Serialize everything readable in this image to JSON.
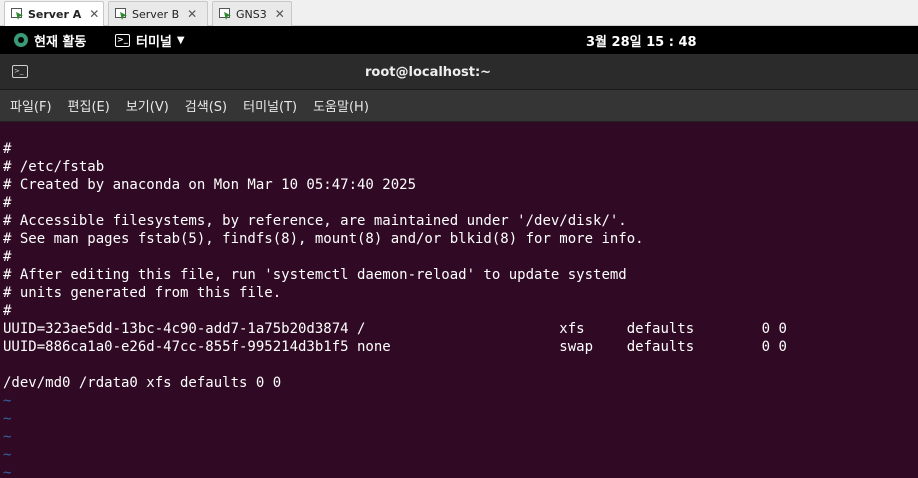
{
  "tabs": [
    {
      "label": "Server A",
      "active": true,
      "closable": true
    },
    {
      "label": "Server B",
      "active": false,
      "closable": true
    },
    {
      "label": "GNS3",
      "active": false,
      "closable": true
    }
  ],
  "topbar": {
    "activities": "현재 활동",
    "app_menu": "터미널",
    "clock": "3월 28일  15 : 48"
  },
  "window": {
    "title": "root@localhost:~"
  },
  "menu": [
    "파일(F)",
    "편집(E)",
    "보기(V)",
    "검색(S)",
    "터미널(T)",
    "도움말(H)"
  ],
  "terminal": {
    "lines": [
      "#",
      "# /etc/fstab",
      "# Created by anaconda on Mon Mar 10 05:47:40 2025",
      "#",
      "# Accessible filesystems, by reference, are maintained under '/dev/disk/'.",
      "# See man pages fstab(5), findfs(8), mount(8) and/or blkid(8) for more info.",
      "#",
      "# After editing this file, run 'systemctl daemon-reload' to update systemd",
      "# units generated from this file.",
      "#",
      "UUID=323ae5dd-13bc-4c90-add7-1a75b20d3874 /                       xfs     defaults        0 0",
      "UUID=886ca1a0-e26d-47cc-855f-995214d3b1f5 none                    swap    defaults        0 0",
      "",
      "/dev/md0 /rdata0 xfs defaults 0 0",
      "~",
      "~",
      "~",
      "~",
      "~"
    ]
  },
  "colors": {
    "terminal_bg": "#300a24",
    "terminal_fg": "#ffffff",
    "tilde": "#3465a4"
  }
}
